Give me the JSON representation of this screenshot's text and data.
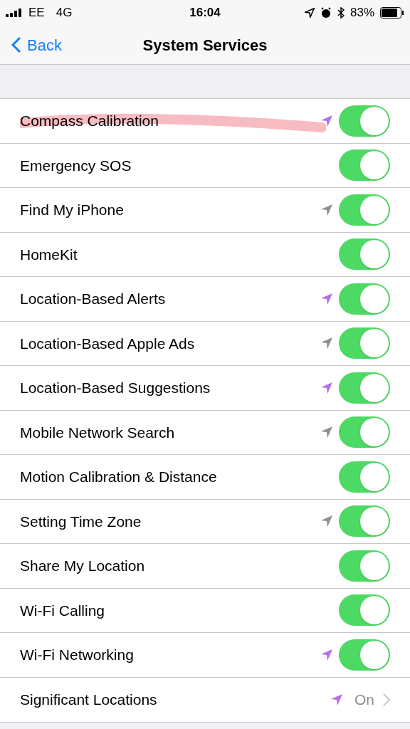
{
  "status_bar": {
    "carrier": "EE",
    "network": "4G",
    "time": "16:04",
    "battery": "83%"
  },
  "nav": {
    "back": "Back",
    "title": "System Services"
  },
  "rows": [
    {
      "kind": "toggle",
      "label": "Compass Calibration",
      "on": true,
      "color": "#b56cf0",
      "highlighted": true
    },
    {
      "kind": "toggle",
      "label": "Emergency SOS",
      "on": true
    },
    {
      "kind": "toggle",
      "label": "Find My iPhone",
      "on": true,
      "color": "#8e8e93"
    },
    {
      "kind": "toggle",
      "label": "HomeKit",
      "on": true
    },
    {
      "kind": "toggle",
      "label": "Location-Based Alerts",
      "on": true,
      "color": "#b56cf0"
    },
    {
      "kind": "toggle",
      "label": "Location-Based Apple Ads",
      "on": true,
      "color": "#8e8e93"
    },
    {
      "kind": "toggle",
      "label": "Location-Based Suggestions",
      "on": true,
      "color": "#b56cf0"
    },
    {
      "kind": "toggle",
      "label": "Mobile Network Search",
      "on": true,
      "color": "#8e8e93"
    },
    {
      "kind": "toggle",
      "label": "Motion Calibration & Distance",
      "on": true
    },
    {
      "kind": "toggle",
      "label": "Setting Time Zone",
      "on": true,
      "color": "#8e8e93"
    },
    {
      "kind": "toggle",
      "label": "Share My Location",
      "on": true
    },
    {
      "kind": "toggle",
      "label": "Wi-Fi Calling",
      "on": true
    },
    {
      "kind": "toggle",
      "label": "Wi-Fi Networking",
      "on": true,
      "color": "#b56cf0"
    },
    {
      "kind": "detail",
      "label": "Significant Locations",
      "value": "On",
      "color": "#b56cf0"
    }
  ]
}
